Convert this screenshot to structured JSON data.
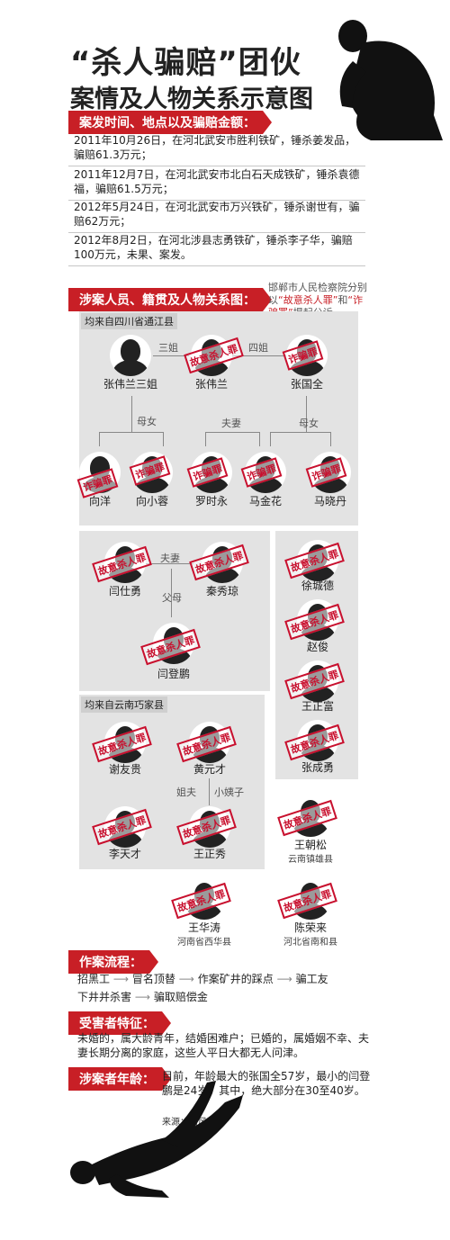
{
  "title": {
    "line1": "“杀人骗赔”团伙",
    "line2": "案情及人物关系示意图"
  },
  "section1": {
    "heading": "案发时间、地点以及骗赔金额：",
    "cases": [
      "2011年10月26日，在河北武安市胜利铁矿，锤杀姜发品，骗赔61.3万元；",
      "2011年12月7日，在河北武安市北白石天成铁矿，锤杀袁德福，骗赔61.5万元；",
      "2012年5月24日，在河北武安市万兴铁矿，锤杀谢世有，骗赔62万元；",
      "2012年8月2日，在河北涉县志勇铁矿，锤杀李子华，骗赔100万元，未果、案发。"
    ]
  },
  "section2": {
    "heading": "涉案人员、籍贯及人物关系图：",
    "note_prefix": "邯郸市人民检察院分别以",
    "note_crime1": "“故意杀人罪”",
    "note_and": "和",
    "note_crime2": "“诈骗罪”",
    "note_suffix": "提起公诉"
  },
  "crimes": {
    "murder": "故意杀人罪",
    "fraud": "诈骗罪"
  },
  "regions": {
    "sichuan": "均来自四川省通江县",
    "yunnan": "均来自云南巧家县"
  },
  "relations": {
    "sister3": "三姐",
    "sister4": "四姐",
    "mother_daughter": "母女",
    "couple": "夫妻",
    "parents": "父母",
    "brother_in_law": "姐夫",
    "younger_sister_in_law": "小姨子"
  },
  "people": {
    "zwl_sister": "张伟兰三姐",
    "zwl": "张伟兰",
    "zgq": "张国全",
    "p_a": "向洋",
    "xxr": "向小蓉",
    "lsy": "罗时永",
    "mjh": "马金花",
    "mxd": "马晓丹",
    "wsy": "闫仕勇",
    "qxq": "秦秀琼",
    "wdp": "闫登鹏",
    "xcd": "徐城德",
    "zj": "赵俊",
    "wzf": "王正富",
    "zcy": "张成勇",
    "xyg": "谢友贵",
    "hyc": "黄元才",
    "ltc": "李天才",
    "wzx": "王正秀",
    "wcs": "王朝松",
    "wcs_place": "云南镇雄县",
    "wht": "王华涛",
    "wht_place": "河南省西华县",
    "crl": "陈荣来",
    "crl_place": "河北省南和县"
  },
  "section3": {
    "heading": "作案流程：",
    "steps": [
      "招黑工",
      "冒名顶替",
      "作案矿井的踩点",
      "骗工友下井并杀害",
      "骗取赔偿金"
    ],
    "step4a": "骗工友",
    "step4b": "下井并杀害"
  },
  "section4": {
    "heading": "受害者特征：",
    "text": "未婚的，属大龄青年，结婚困难户；已婚的，属婚姻不幸、夫妻长期分离的家庭，这些人平日大都无人问津。"
  },
  "section5": {
    "heading": "涉案者年龄：",
    "text": "目前，年龄最大的张国全57岁，最小的闫登鹏是24岁。其中，绝大部分在30至40岁。",
    "source": "来源：南风窗"
  }
}
